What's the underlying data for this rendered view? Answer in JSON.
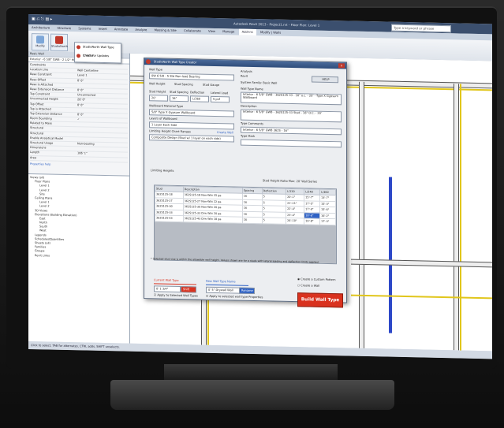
{
  "app": {
    "title": "Autodesk Revit 2013 - Project1.rvt - Floor Plan: Level 1",
    "search_placeholder": "Type a keyword or phrase"
  },
  "ribbon": {
    "tabs": [
      "Architecture",
      "Structure",
      "Systems",
      "Insert",
      "Annotate",
      "Analyze",
      "Massing & Site",
      "Collaborate",
      "View",
      "Manage",
      "Add-Ins",
      "Modify | Walls"
    ],
    "active_tab": "Add-Ins",
    "buttons": [
      {
        "label": "Modify"
      },
      {
        "label": "StudioNorth"
      }
    ]
  },
  "dropdown_menu": {
    "items": [
      "StudioNorth Wall Type Creator",
      "Check for Updates"
    ]
  },
  "properties": {
    "header": "Basic Wall",
    "type_name": "Exterior - 6 5/8\" GWB - 2 1/2\" Mtl. Stud",
    "rows": [
      [
        "Constraints",
        ""
      ],
      [
        "Location Line",
        "Wall Centerline"
      ],
      [
        "Base Constraint",
        "Level 1"
      ],
      [
        "Base Offset",
        "0' 0\""
      ],
      [
        "Base is Attached",
        ""
      ],
      [
        "Base Extension Distance",
        "0' 0\""
      ],
      [
        "Top Constraint",
        "Unconnected"
      ],
      [
        "Unconnected Height",
        "20' 0\""
      ],
      [
        "Top Offset",
        "0' 0\""
      ],
      [
        "Top is Attached",
        ""
      ],
      [
        "Top Extension Distance",
        "0' 0\""
      ],
      [
        "Room Bounding",
        "✓"
      ],
      [
        "Related to Mass",
        ""
      ],
      [
        "Structural",
        ""
      ],
      [
        "Structural",
        ""
      ],
      [
        "Enable Analytical Model",
        ""
      ],
      [
        "Structural Usage",
        "Non-bearing"
      ],
      [
        "Dimensions",
        ""
      ],
      [
        "Length",
        "106' 1\""
      ],
      [
        "Area",
        ""
      ]
    ],
    "help_link": "Properties help"
  },
  "project_browser": {
    "items": [
      "Views (all)",
      "Floor Plans",
      "Level 1",
      "Level 2",
      "Site",
      "Ceiling Plans",
      "Level 1",
      "Level 2",
      "3D Views",
      "Elevations (Building Elevation)",
      "East",
      "North",
      "South",
      "West",
      "Legends",
      "Schedules/Quantities",
      "Sheets (all)",
      "Families",
      "Groups",
      "Revit Links"
    ]
  },
  "statusbar": {
    "text": "Click to select, TAB for alternates, CTRL adds, SHIFT unselects."
  },
  "dialog": {
    "title": "StudioNorth Wall Type Creator",
    "close": "x",
    "wall_type_label": "Wall Type",
    "wall_type_value": "0W 6 5/8 - 5 Std Non-load Bearing",
    "help": "HELP",
    "tabs": [
      "Wall Height",
      "Stud Spacing",
      "Stud Gauge"
    ],
    "stud_height_label": "Stud Height",
    "stud_height_value": "20'",
    "stud_spacing_label": "Stud Spacing",
    "stud_spacing_value": "16\"",
    "deflection_label": "Deflection",
    "deflection_value": "L/360",
    "lateral_load_label": "Lateral Load",
    "lateral_load_value": "5 psf",
    "wall_material_label": "Wallboard Material Type",
    "wall_material_value": "5/8\" Type X Gypsum Wallboard",
    "layers_label": "Layers of Wallboard",
    "layers_value": "1 Layer Each Side",
    "limiting_label": "Limiting Height Chart Ranges",
    "limiting_link": "Create Wall",
    "limiting_value": "Composite Design (Stud w/ 1 layer on each side)",
    "grid_label": "Limiting Heights",
    "grid_caption": "Stud Height Ratio Max: 20' Wall Series",
    "grid_headers": [
      "Stud",
      "Description",
      "Spacing",
      "Deflection",
      "L/120",
      "L/240",
      "L/360"
    ],
    "grid_rows": [
      [
        "362S125-18",
        "362S125-18 Non-Wkt 25 ga",
        "16",
        "5",
        "20'-1\"",
        "15'-7\"",
        "13'-7\""
      ],
      [
        "362S125-27",
        "362S125-27 Non-Wkt 22 ga",
        "16",
        "5",
        "21'-11\"",
        "17'-5\"",
        "15'-3\""
      ],
      [
        "362S125-30",
        "362S125-30 Non-Wkt 20 ga",
        "16",
        "5",
        "22'-4\"",
        "17'-9\"",
        "15'-6\""
      ],
      [
        "362S125-33",
        "362S125-33 Drw Wkt 20 ga",
        "16",
        "5",
        "23'-4\"",
        "18'-6\"",
        "16'-2\""
      ],
      [
        "362S125-43",
        "362S125-43 Drw Wkt 18 ga",
        "16",
        "5",
        "24'-10\"",
        "19'-8\"",
        "17'-3\""
      ]
    ],
    "footnote": "* Selected stud size is within the allowable wall height. Values shown are for a studs with lateral loading and deflection limits applied.",
    "right": {
      "label1": "Analysis",
      "value1": "Revit",
      "label2": "System Family: Basic Wall",
      "value2": "Basic Wall",
      "label3": "Wall Type Name",
      "value3": "Interior - 6 5/8\" GWB - 362S125-33 - 16\" o.c. - 20' - Type X Gypsum Wallboard",
      "label4": "Description",
      "value4": "Interior - 6 5/8\" GWB - 362S125-33 Stud - 16\" O.C. - 20'",
      "label5": "Type Comments",
      "value5": "Interior - 6 5/8\" GWB 362S - 16\"",
      "label6": "Type Mark",
      "value6": ""
    },
    "new_wall_label": "Current Wall Type",
    "new_wall_value": "0' 1 3/4\"",
    "new_wall_btn": "Shift",
    "apply_checkbox": "Apply to Selected Wall Types",
    "new_type_label": "New Wall Type Name",
    "new_type_value": "0' 5\" Drywall Wall",
    "new_type_btn": "Rename",
    "apply2": "Apply to selected wall type Properties",
    "option1": "Create a Custom Pattern",
    "option2": "Create a Wall",
    "build": "Build Wall Type"
  },
  "colors": {
    "build_button": "#d9321f",
    "selection": "#2f62c5",
    "titlebar": "#3b4f6e"
  }
}
